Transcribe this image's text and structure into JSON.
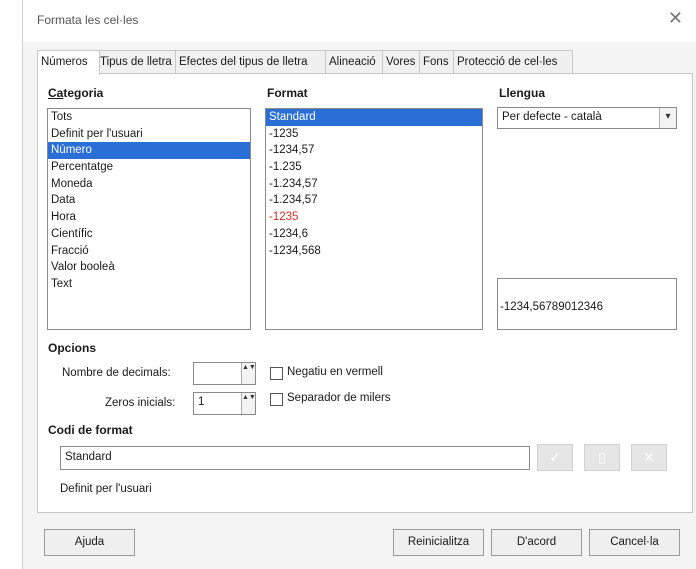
{
  "window": {
    "title": "Formata les cel·les",
    "close_glyph": "✕"
  },
  "tabs": [
    {
      "label": "Números",
      "active": true
    },
    {
      "label": "Tipus de lletra"
    },
    {
      "label": "Efectes del tipus de lletra"
    },
    {
      "label": "Alineació"
    },
    {
      "label": "Vores"
    },
    {
      "label": "Fons"
    },
    {
      "label": "Protecció de cel·les"
    }
  ],
  "category": {
    "header": "Categoria",
    "items": [
      "Tots",
      "Definit per l'usuari",
      "Número",
      "Percentatge",
      "Moneda",
      "Data",
      "Hora",
      "Científic",
      "Fracció",
      "Valor booleà",
      "Text"
    ],
    "selected": "Número"
  },
  "format": {
    "header": "Format",
    "items": [
      "Standard",
      "-1235",
      "-1234,57",
      "-1.235",
      "-1.234,57",
      "-1.234,57",
      "-1235",
      "-1234,6",
      "-1234,568"
    ],
    "selected": "Standard",
    "red_item": "-1235"
  },
  "language": {
    "header": "Llengua",
    "value": "Per defecte - català",
    "dropdown_glyph": "▾"
  },
  "preview": "-1234,56789012346",
  "options": {
    "header": "Opcions",
    "decimals_label": "Nombre de decimals:",
    "decimals_value": "",
    "leading_zeros_label": "Zeros inicials:",
    "leading_zeros_value": "1",
    "negative_red_label": "Negatiu en vermell",
    "negative_red_checked": false,
    "thousands_label": "Separador de milers",
    "thousands_checked": false,
    "spin_glyphs": "▲▼"
  },
  "format_code": {
    "header": "Codi de format",
    "value": "Standard",
    "description": "Definit per l'usuari",
    "icons": [
      "check-icon",
      "comment-icon",
      "delete-icon"
    ],
    "icon_glyphs": [
      "✓",
      "▯",
      "✕"
    ]
  },
  "buttons": {
    "help": "Ajuda",
    "reset": "Reinicialitza",
    "ok": "D'acord",
    "cancel": "Cancel·la"
  },
  "colors": {
    "selection": "#2a6fd6",
    "negative_red": "#d0302a"
  }
}
